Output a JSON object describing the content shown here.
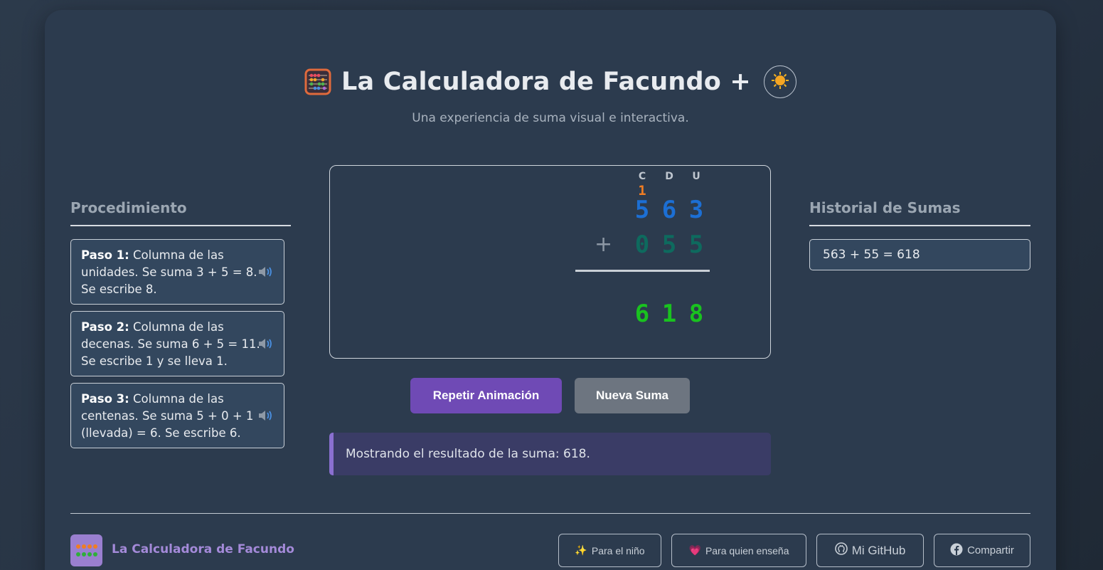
{
  "header": {
    "title": "La Calculadora de Facundo +",
    "subtitle": "Una experiencia de suma visual e interactiva.",
    "theme_icon": "sun-icon"
  },
  "procedure": {
    "title": "Procedimiento",
    "steps": [
      {
        "label": "Paso 1:",
        "text": " Columna de las unidades. Se suma 3 + 5 = 8. Se escribe 8."
      },
      {
        "label": "Paso 2:",
        "text": " Columna de las decenas. Se suma 6 + 5 = 11. Se escribe 1 y se lleva 1."
      },
      {
        "label": "Paso 3:",
        "text": " Columna de las centenas. Se suma 5 + 0 + 1 (llevada) = 6. Se escribe 6."
      }
    ]
  },
  "board": {
    "columns": [
      "C",
      "D",
      "U"
    ],
    "carry": "1",
    "top_digits": [
      "5",
      "6",
      "3"
    ],
    "operator": "+",
    "bottom_digits": [
      "0",
      "5",
      "5"
    ],
    "result_digits": [
      "6",
      "1",
      "8"
    ]
  },
  "buttons": {
    "repeat": "Repetir Animación",
    "new_sum": "Nueva Suma"
  },
  "status_message": "Mostrando el resultado de la suma: 618.",
  "history": {
    "title": "Historial de Sumas",
    "items": [
      "563 + 55 = 618"
    ]
  },
  "footer": {
    "brand": "La Calculadora de Facundo",
    "links": [
      {
        "label": "Para el niño",
        "icon": "sparkles-icon"
      },
      {
        "label": "Para quien enseña",
        "icon": "heart-icon"
      },
      {
        "label": "Mi GitHub",
        "icon": "github-icon"
      },
      {
        "label": "Compartir",
        "icon": "facebook-icon"
      }
    ]
  },
  "colors": {
    "accent": "#6f4ab5",
    "top_number": "#1c6fd4",
    "bottom_number": "#0e6a5e",
    "result_number": "#19c21f",
    "carry": "#f07d23"
  }
}
